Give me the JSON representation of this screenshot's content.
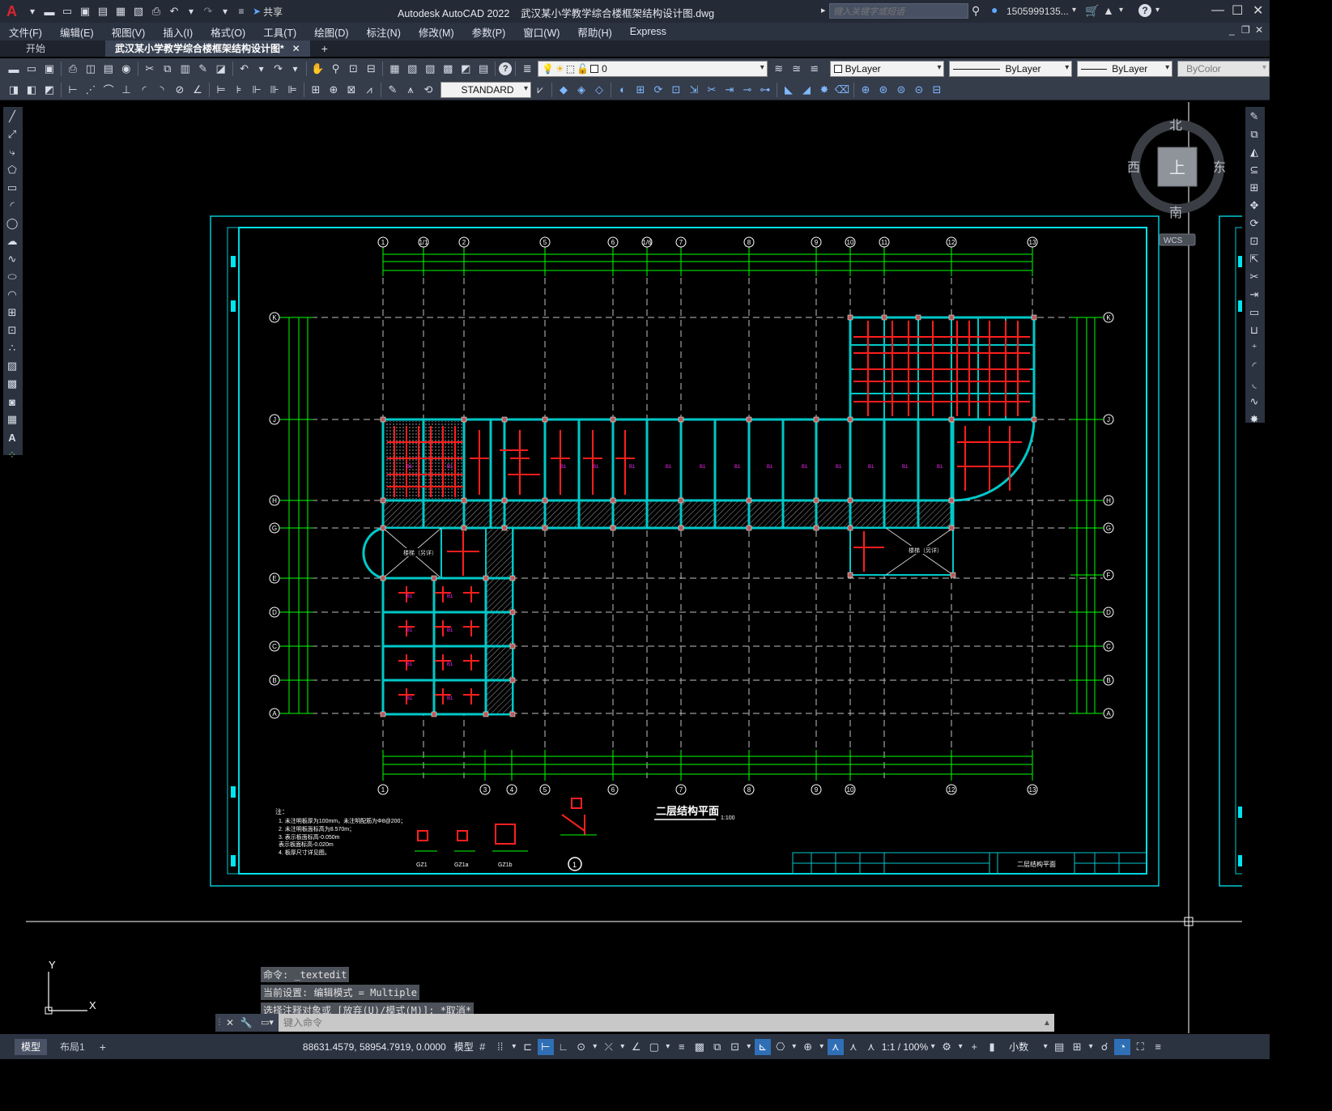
{
  "titlebar": {
    "app_logo": "A",
    "share_label": "共享",
    "title": "Autodesk AutoCAD 2022    武汉某小学教学综合楼框架结构设计图.dwg",
    "search_placeholder": "键入关键字或短语",
    "user": "1505999135...",
    "window_buttons": [
      "minimize",
      "maximize",
      "close"
    ]
  },
  "menubar": {
    "items": [
      "文件(F)",
      "编辑(E)",
      "视图(V)",
      "插入(I)",
      "格式(O)",
      "工具(T)",
      "绘图(D)",
      "标注(N)",
      "修改(M)",
      "参数(P)",
      "窗口(W)",
      "帮助(H)",
      "Express"
    ]
  },
  "tabs": {
    "start": "开始",
    "active": "武汉某小学教学综合楼框架结构设计图*"
  },
  "properties": {
    "layer": "0",
    "color": "ByLayer",
    "linetype": "ByLayer",
    "lineweight": "ByLayer",
    "plotstyle": "ByColor",
    "textstyle": "STANDARD"
  },
  "viewcube": {
    "north": "北",
    "south": "南",
    "east": "东",
    "west": "西",
    "face": "上",
    "ucs": "WCS"
  },
  "drawing": {
    "title": "二层结构平面",
    "scale": "1:100",
    "axis_top": [
      "1",
      "1/1",
      "2",
      "5",
      "6",
      "1/6",
      "7",
      "8",
      "9",
      "10",
      "11",
      "12",
      "13"
    ],
    "axis_bottom": [
      "1",
      "3",
      "4",
      "5",
      "6",
      "7",
      "8",
      "9",
      "10",
      "12",
      "13"
    ],
    "axis_left": [
      "K",
      "J",
      "H",
      "G",
      "E",
      "D",
      "C",
      "B",
      "A"
    ],
    "axis_right": [
      "K",
      "J",
      "H",
      "G",
      "F",
      "D",
      "C",
      "B",
      "A"
    ],
    "notes_head": "注：",
    "notes": [
      "1. 未注明板厚为100mm，未注明配筋为Φ8@200；",
      "2. 未注明板面标高为8.570m；",
      "3.    表示板面标高-0.050m",
      "      表示板面标高-0.020m",
      "4. 板厚尺寸详见图。"
    ],
    "col_labels": [
      "GZ1",
      "GZ1a",
      "GZ1b"
    ],
    "detail_label": "1",
    "stair_label": "楼梯（另详）",
    "titleblock_name": "二层结构平面"
  },
  "command": {
    "history": [
      "命令: _textedit",
      "当前设置: 编辑模式 = Multiple",
      "选择注释对象或 [放弃(U)/模式(M)]: *取消*"
    ],
    "placeholder": "键入命令"
  },
  "ucs_icon": {
    "x": "X",
    "y": "Y"
  },
  "status": {
    "tab_model": "模型",
    "tab_layout": "布局1",
    "coords": "88631.4579, 58954.7919, 0.0000",
    "space": "模型",
    "scale": "1:1 / 100%",
    "units": "小数"
  }
}
